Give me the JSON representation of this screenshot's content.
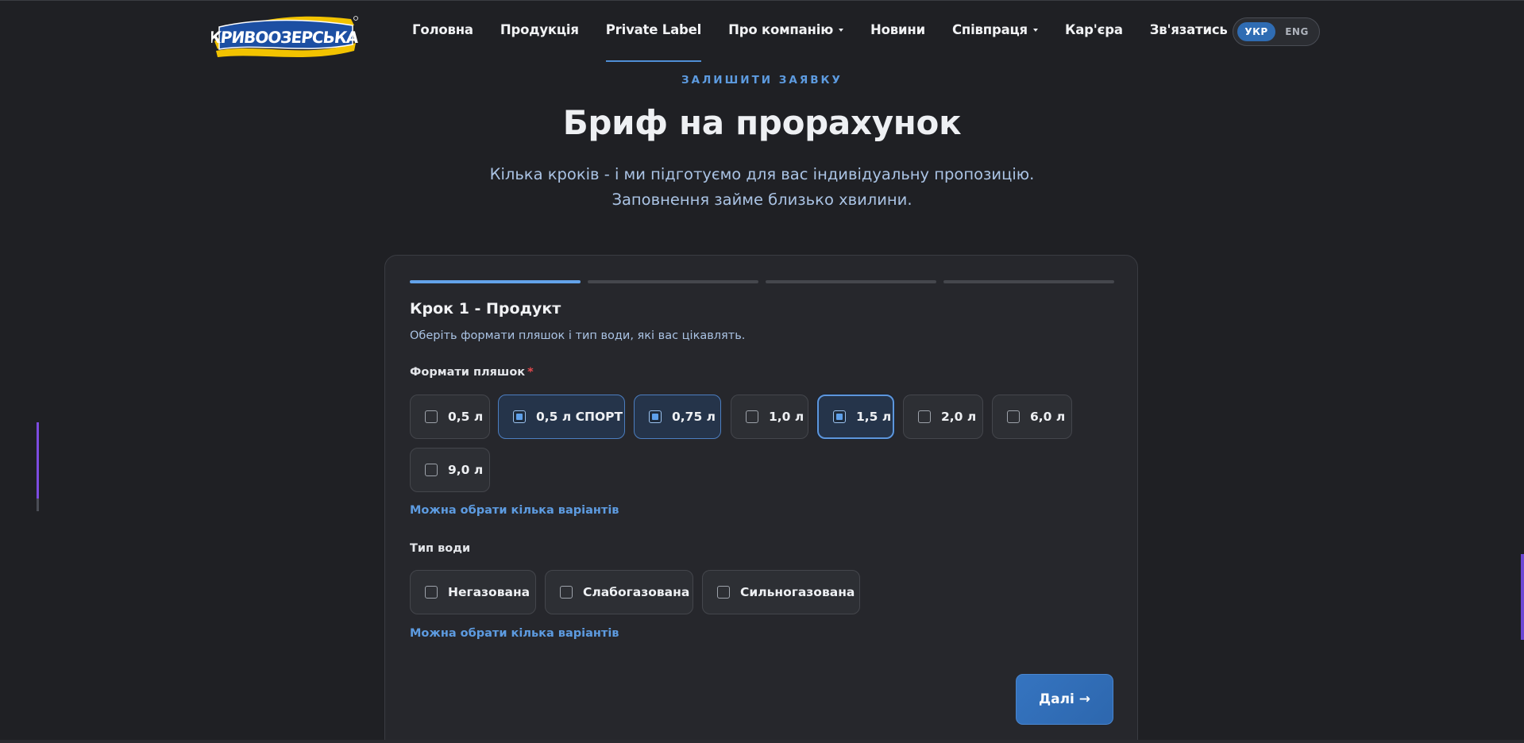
{
  "header": {
    "logo_text": "КРИВООЗЕРСЬКА",
    "nav": [
      {
        "label": "Головна"
      },
      {
        "label": "Продукція"
      },
      {
        "label": "Private Label"
      },
      {
        "label": "Про компанію"
      },
      {
        "label": "Новини"
      },
      {
        "label": "Співпраця"
      },
      {
        "label": "Кар'єра"
      },
      {
        "label": "Зв'язатись"
      }
    ],
    "lang": {
      "active": "УКР",
      "other": "ENG"
    }
  },
  "hero": {
    "eyebrow": "ЗАЛИШИТИ ЗАЯВКУ",
    "title": "Бриф на прорахунок",
    "subtitle_line1": "Кілька кроків - і ми підготуємо для вас індивідуальну пропозицію.",
    "subtitle_line2": "Заповнення займе близько хвилини."
  },
  "form": {
    "progress": {
      "current_step": 1,
      "total_steps": 4
    },
    "step_title": "Крок 1 - Продукт",
    "step_desc": "Оберіть формати пляшок і тип води, які вас цікавлять.",
    "bottle_label": "Формати пляшок",
    "required_mark": "*",
    "bottles": [
      {
        "label": "0,5 л",
        "selected": false
      },
      {
        "label": "0,5 л СПОРТ",
        "selected": true
      },
      {
        "label": "0,75 л",
        "selected": true
      },
      {
        "label": "1,0 л",
        "selected": false
      },
      {
        "label": "1,5 л",
        "selected": true
      },
      {
        "label": "2,0 л",
        "selected": false
      },
      {
        "label": "6,0 л",
        "selected": false
      },
      {
        "label": "9,0 л",
        "selected": false
      }
    ],
    "bottle_hint": "Можна обрати кілька варіантів",
    "water_label": "Тип води",
    "water": [
      {
        "label": "Негазована",
        "selected": false
      },
      {
        "label": "Слабогазована",
        "selected": false
      },
      {
        "label": "Сильногазована",
        "selected": false
      }
    ],
    "water_hint": "Можна обрати кілька варіантів",
    "next_label": "Далі →"
  },
  "colors": {
    "background": "#1f2024",
    "card": "#26272c",
    "accent": "#5d9be0",
    "selected_bg": "#25344a",
    "button": "#2f6cb3",
    "required": "#e5484d"
  }
}
